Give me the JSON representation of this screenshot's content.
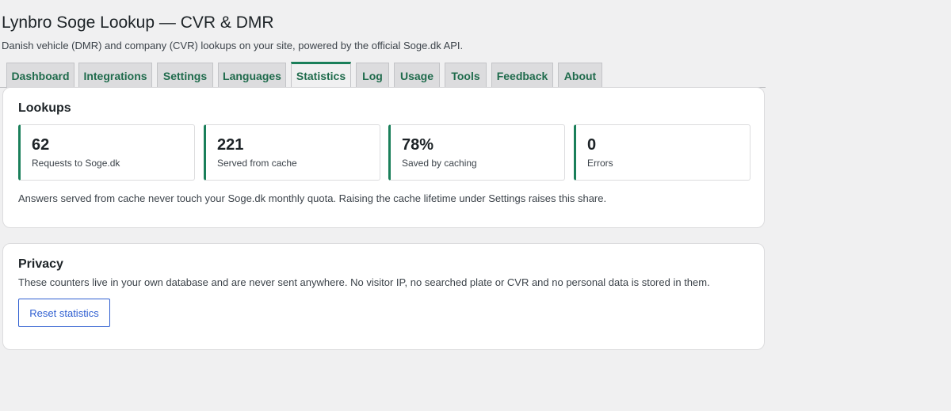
{
  "header": {
    "title": "Lynbro Soge Lookup — CVR & DMR",
    "subtitle": "Danish vehicle (DMR) and company (CVR) lookups on your site, powered by the official Soge.dk API."
  },
  "tabs": [
    {
      "label": "Dashboard"
    },
    {
      "label": "Integrations"
    },
    {
      "label": "Settings"
    },
    {
      "label": "Languages"
    },
    {
      "label": "Statistics",
      "active": true
    },
    {
      "label": "Log"
    },
    {
      "label": "Usage"
    },
    {
      "label": "Tools"
    },
    {
      "label": "Feedback"
    },
    {
      "label": "About"
    }
  ],
  "lookups": {
    "title": "Lookups",
    "stats": [
      {
        "value": "62",
        "label": "Requests to Soge.dk"
      },
      {
        "value": "221",
        "label": "Served from cache"
      },
      {
        "value": "78%",
        "label": "Saved by caching"
      },
      {
        "value": "0",
        "label": "Errors"
      }
    ],
    "note": "Answers served from cache never touch your Soge.dk monthly quota. Raising the cache lifetime under Settings raises this share."
  },
  "privacy": {
    "title": "Privacy",
    "text": "These counters live in your own database and are never sent anywhere. No visitor IP, no searched plate or CVR and no personal data is stored in them.",
    "reset_label": "Reset statistics"
  },
  "colors": {
    "accent": "#1a7f5a",
    "tab_text": "#1f6b4c",
    "button_blue": "#2f5fd1",
    "background": "#f0f0f1"
  }
}
